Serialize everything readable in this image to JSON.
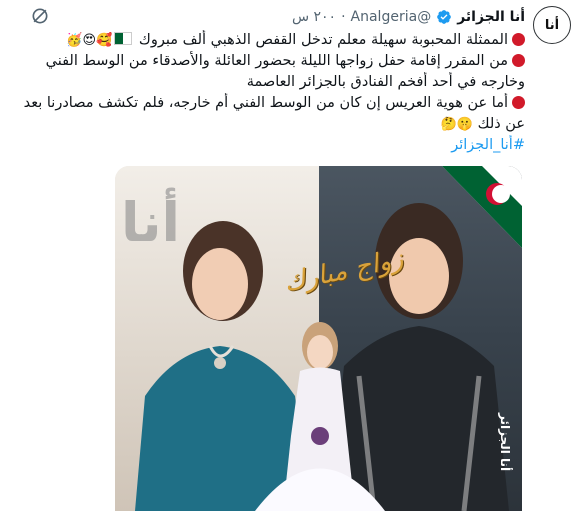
{
  "author": {
    "display_name": "أنا الجزائر",
    "handle": "@Analgeria",
    "avatar_text": "أنا",
    "verified": true
  },
  "meta": {
    "separator": "·",
    "time": "٢٠٠ س"
  },
  "body": {
    "line1": "الممثلة المحبوبة سهيلة معلم تدخل القفص الذهبي ألف مبروك",
    "line1_emojis": "🥰😍🥳",
    "line2": "من المقرر إقامة حفل زواجها الليلة بحضور العائلة والأصدقاء من الوسط الفني",
    "line3": "وخارجه في أحد أفخم الفنادق بالجزائر العاصمة",
    "line4": "أما عن هوية العريس إن كان من الوسط الفني أم خارجه، فلم تكشف مصادرنا بعد",
    "line5": "عن ذلك",
    "line5_emojis": "🤫🤔",
    "hashtag": "#أنا_الجزائر"
  },
  "media": {
    "logo_text": "أنا",
    "wedding_text": "زواج مبارك",
    "watermark": "أنا الجزائر"
  },
  "icons": {
    "more": "grok-icon",
    "verified": "verified-badge-icon"
  },
  "colors": {
    "accent": "#1d9bf0",
    "text": "#0f1419",
    "muted": "#536471",
    "bullet": "#d11a2a"
  }
}
